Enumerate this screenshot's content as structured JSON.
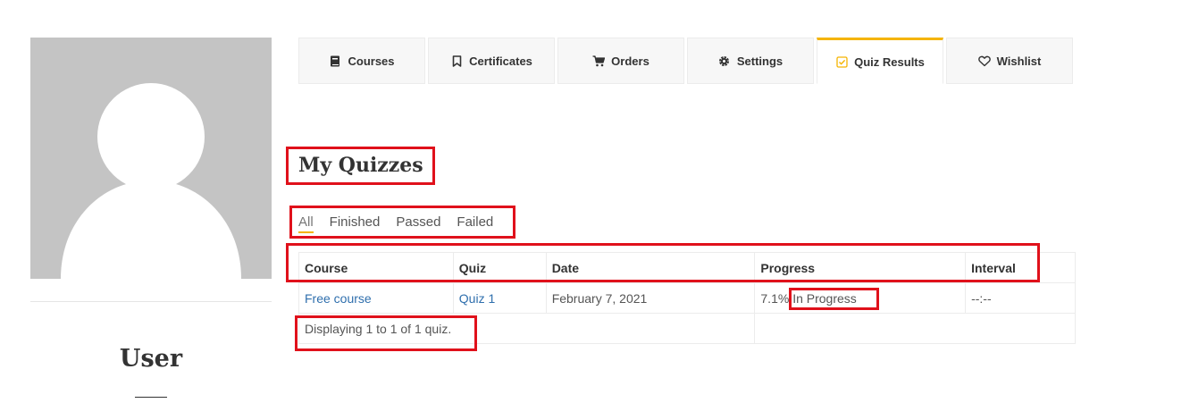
{
  "profile": {
    "username": "User"
  },
  "tabs": [
    {
      "label": "Courses",
      "icon": "book-icon",
      "active": false
    },
    {
      "label": "Certificates",
      "icon": "bookmark-icon",
      "active": false
    },
    {
      "label": "Orders",
      "icon": "cart-icon",
      "active": false
    },
    {
      "label": "Settings",
      "icon": "gear-icon",
      "active": false
    },
    {
      "label": "Quiz Results",
      "icon": "checkbox-icon",
      "active": true
    },
    {
      "label": "Wishlist",
      "icon": "heart-icon",
      "active": false
    }
  ],
  "section": {
    "title": "My Quizzes"
  },
  "filters": [
    {
      "label": "All",
      "active": true
    },
    {
      "label": "Finished",
      "active": false
    },
    {
      "label": "Passed",
      "active": false
    },
    {
      "label": "Failed",
      "active": false
    }
  ],
  "table": {
    "headers": {
      "course": "Course",
      "quiz": "Quiz",
      "date": "Date",
      "progress": "Progress",
      "interval": "Interval"
    },
    "rows": [
      {
        "course": "Free course",
        "quiz": "Quiz 1",
        "date": "February 7, 2021",
        "progress_percent": "7.1%",
        "progress_status": "In Progress",
        "interval": "--:--"
      }
    ],
    "footer": "Displaying 1 to 1 of 1 quiz."
  },
  "colors": {
    "accent": "#f5b400",
    "link": "#2f6fad",
    "highlight": "#e0111b",
    "avatar_bg": "#c4c4c4"
  }
}
